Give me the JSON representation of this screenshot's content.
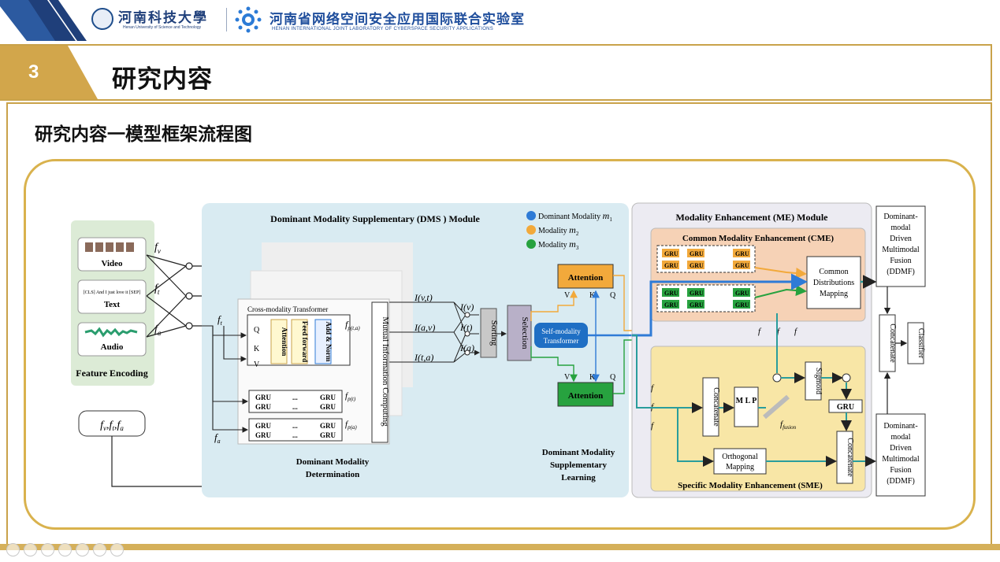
{
  "header": {
    "school_name": "河南科技大學",
    "school_en": "Henan University of Science and Technology",
    "lab_name": "河南省网络空间安全应用国际联合实验室",
    "lab_en": "HENAN INTERNATIONAL JOINT LABORATORY OF CYBERSPACE SECURITY APPLICATIONS"
  },
  "section": {
    "number": "3",
    "title": "研究内容"
  },
  "content": {
    "title": "研究内容一模型框架流程图"
  },
  "diagram": {
    "feature_encoding": {
      "video": "Video",
      "text": "Text",
      "audio": "Audio",
      "title": "Feature Encoding",
      "text_sample": "[CLS] And I just love it [SEP]"
    },
    "symbols": {
      "fv": "f",
      "fv_sub": "v",
      "ft": "f",
      "ft_sub": "t",
      "fa": "f",
      "fa_sub": "a",
      "triple": "f",
      "comma": ",",
      "fp_ta": "f",
      "fp_ta_sub": "p(t,a)",
      "fp_t": "f",
      "fp_t_sub": "p(t)",
      "fp_a": "f",
      "fp_a_sub": "p(a)",
      "i_vt": "I(v,t)",
      "i_av": "I(a,v)",
      "i_ta": "I(t,a)",
      "i_v": "I(v)",
      "i_t": "I(t)",
      "i_a": "I(a)"
    },
    "dms": {
      "title": "Dominant Modality Supplementary (DMS ) Module",
      "cross_transformer": "Cross-modality Transformer",
      "q": "Q",
      "k": "K",
      "v": "V",
      "attention": "Attention",
      "feed_forward": "Feed forward",
      "add_norm": "Add & Norm",
      "gru": "GRU",
      "dots": "...",
      "mutual_info": "Mutual Information Computing",
      "sorting": "Sorting",
      "selection": "Selection",
      "determination_l1": "Dominant Modality",
      "determination_l2": "Determination",
      "learning_l1": "Dominant Modality",
      "learning_l2": "Supplementary",
      "learning_l3": "Learning",
      "self_transformer_l1": "Self-modality",
      "self_transformer_l2": "Transformer",
      "attention_top": "Attention",
      "attention_bottom": "Attention"
    },
    "legend": {
      "items": [
        {
          "label": "Dominant Modality ",
          "sym": "m",
          "sub": "1",
          "color": "#2f7bd6"
        },
        {
          "label": "Modality ",
          "sym": "m",
          "sub": "2",
          "color": "#f2a93b"
        },
        {
          "label": "Modality ",
          "sym": "m",
          "sub": "3",
          "color": "#27a23f"
        }
      ]
    },
    "me": {
      "title": "Modality Enhancement (ME) Module",
      "cme_title": "Common Modality Enhancement (CME)",
      "common_mapping_l1": "Common",
      "common_mapping_l2": "Distributions",
      "common_mapping_l3": "Mapping",
      "sme_title": "Specific Modality Enhancement (SME)",
      "concatenate": "Concatenate",
      "mlp": "M L P",
      "sigmoid": "Sigmoid",
      "gru": "GRU",
      "orthogonal_l1": "Orthogonal",
      "orthogonal_l2": "Mapping",
      "f_fusion": "f",
      "f_fusion_sub": "fusion",
      "fm2": "f",
      "fm1": "f",
      "fm3": "f"
    },
    "ddmf": {
      "top_l1": "Dominant-",
      "top_l2": "modal",
      "top_l3": "Driven",
      "top_l4": "Multimodal",
      "top_l5": "Fusion",
      "top_l6": "(DDMF)",
      "bottom_l1": "Dominant-",
      "bottom_l2": "modal",
      "bottom_l3": "Driven",
      "bottom_l4": "Multimodal",
      "bottom_l5": "Fusion",
      "bottom_l6": "(DDMF)",
      "concatenate": "Concatenate",
      "classifier": "Classifier"
    },
    "colors": {
      "dms_bg": "#d9ebf2",
      "me_bg": "#ecebf2",
      "cme_bg": "#f6d2b6",
      "sme_bg": "#f8e6a6",
      "orange": "#f2a93b",
      "green": "#27a23f",
      "blue": "#2f7bd6",
      "teal": "#2a9d9c"
    }
  },
  "nav": {
    "icons": [
      "prev-icon",
      "next-icon",
      "pen-icon",
      "grid-icon",
      "zoom-icon",
      "view-icon",
      "more-icon"
    ]
  }
}
